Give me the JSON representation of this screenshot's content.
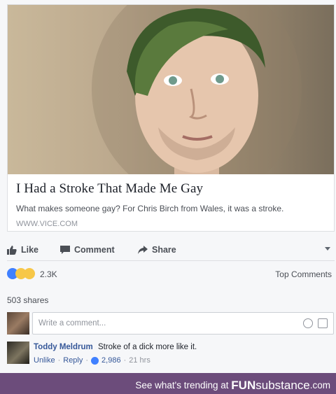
{
  "article": {
    "headline": "I Had a Stroke That Made Me Gay",
    "description": "What makes someone gay? For Chris Birch from Wales, it was a stroke.",
    "domain": "WWW.VICE.COM"
  },
  "actions": {
    "like_label": "Like",
    "comment_label": "Comment",
    "share_label": "Share"
  },
  "reactions": {
    "count": "2.3K",
    "sort_label": "Top Comments"
  },
  "shares": "503 shares",
  "composer": {
    "placeholder": "Write a comment..."
  },
  "comment": {
    "author": "Toddy Meldrum",
    "text": "Stroke of a dick more like it.",
    "unlike_label": "Unlike",
    "reply_label": "Reply",
    "like_count": "2,986",
    "time": "21 hrs"
  },
  "footer": {
    "lead_text": "See what's trending at",
    "brand_bold": "FUN",
    "brand_rest": "substance",
    "brand_tld": ".com",
    "color": "#6c4c7b"
  },
  "colors": {
    "link": "#365899",
    "accent_like": "#4080ff"
  }
}
